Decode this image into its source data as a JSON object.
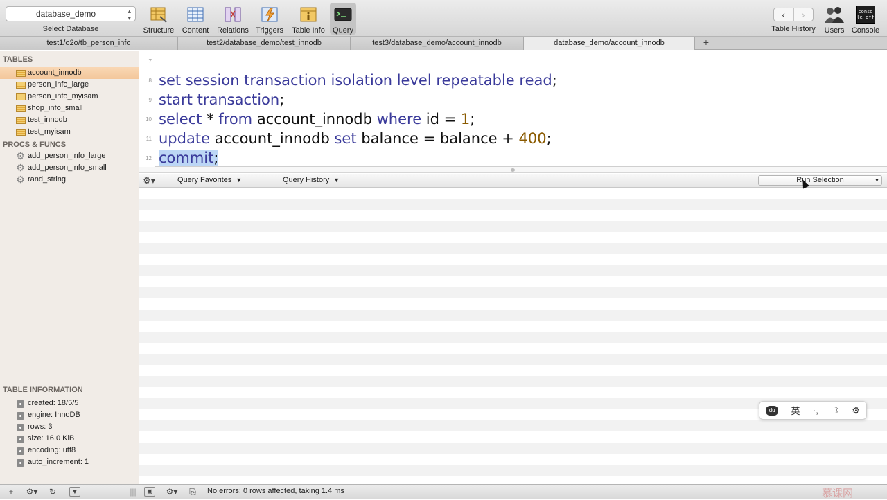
{
  "toolbar": {
    "database_select": "database_demo",
    "database_caption": "Select Database",
    "buttons": [
      {
        "label": "Structure",
        "icon": "structure-icon"
      },
      {
        "label": "Content",
        "icon": "content-icon"
      },
      {
        "label": "Relations",
        "icon": "relations-icon"
      },
      {
        "label": "Triggers",
        "icon": "triggers-icon"
      },
      {
        "label": "Table Info",
        "icon": "table-info-icon"
      },
      {
        "label": "Query",
        "icon": "query-icon"
      }
    ],
    "table_history_label": "Table History",
    "users_label": "Users",
    "console_label": "Console",
    "console_icon_text": "conso le off"
  },
  "tabs": [
    {
      "label": "test1/o2o/tb_person_info"
    },
    {
      "label": "test2/database_demo/test_innodb"
    },
    {
      "label": "test3/database_demo/account_innodb"
    },
    {
      "label": "database_demo/account_innodb"
    }
  ],
  "tab_add": "+",
  "sidebar": {
    "tables_heading": "TABLES",
    "tables": [
      {
        "label": "account_innodb"
      },
      {
        "label": "person_info_large"
      },
      {
        "label": "person_info_myisam"
      },
      {
        "label": "shop_info_small"
      },
      {
        "label": "test_innodb"
      },
      {
        "label": "test_myisam"
      }
    ],
    "procs_heading": "PROCS & FUNCS",
    "procs": [
      {
        "label": "add_person_info_large"
      },
      {
        "label": "add_person_info_small"
      },
      {
        "label": "rand_string"
      }
    ],
    "info_heading": "TABLE INFORMATION",
    "info": [
      {
        "label": "created: 18/5/5"
      },
      {
        "label": "engine: InnoDB"
      },
      {
        "label": "rows: 3"
      },
      {
        "label": "size: 16.0 KiB"
      },
      {
        "label": "encoding: utf8"
      },
      {
        "label": "auto_increment: 1"
      }
    ]
  },
  "editor": {
    "line_numbers": [
      "7",
      "8",
      "9",
      "10",
      "11",
      "12"
    ],
    "line8": {
      "kw": "set session transaction isolation level repeatable read",
      "rest": ";"
    },
    "line9": {
      "kw": "start transaction",
      "rest": ";"
    },
    "line10": {
      "kw1": "select",
      "mid1": " * ",
      "kw2": "from",
      "mid2": " account_innodb ",
      "kw3": "where",
      "mid3": " id = ",
      "num": "1",
      "rest": ";"
    },
    "line11": {
      "kw1": "update",
      "mid1": " account_innodb ",
      "kw2": "set",
      "mid2": " balance = balance + ",
      "num": "400",
      "rest": ";"
    },
    "line12": {
      "kw": "commit",
      "rest": ";"
    }
  },
  "query_bar": {
    "favorites": "Query Favorites",
    "history": "Query History",
    "run_button": "Run Selection"
  },
  "ime_bar": {
    "lang": "英",
    "punct": "·,",
    "moon": "☽",
    "gear": "⚙"
  },
  "status": {
    "message": "No errors; 0 rows affected, taking 1.4 ms"
  },
  "watermark": "慕课网"
}
